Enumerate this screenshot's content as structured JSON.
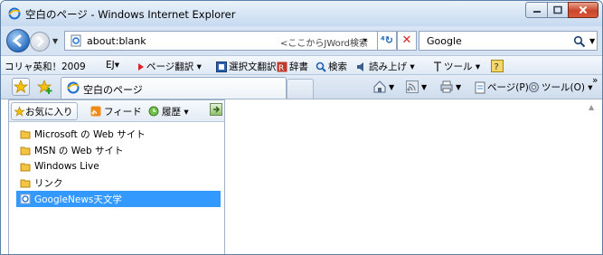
{
  "window": {
    "title": "空白のページ - Windows Internet Explorer",
    "icon": "ie-icon"
  },
  "address_bar": {
    "value": "about:blank",
    "hint": "<ここからJWord検索",
    "hint_dropdown": "▾"
  },
  "search": {
    "value": "Google"
  },
  "toolbar": {
    "items": [
      {
        "label": "コリャ英和！2009"
      },
      {
        "label": "EJ▾"
      },
      {
        "label": "ページ翻訳 ▾"
      },
      {
        "label": "選択文翻訳"
      },
      {
        "label": "辞書"
      },
      {
        "label": "検索"
      },
      {
        "label": "読み上げ ▾"
      },
      {
        "label": "ツール ▾"
      }
    ]
  },
  "tabs": {
    "active_label": "空白のページ"
  },
  "commands": {
    "page_label": "ページ(P) ▾",
    "tools_label": "ツール(O) ▾",
    "more": "»"
  },
  "favorites_pane": {
    "tabs": [
      {
        "label": "お気に入り"
      },
      {
        "label": "フィード"
      },
      {
        "label": "履歴 ▾"
      }
    ],
    "items": [
      {
        "label": "Microsoft の Web サイト",
        "icon": "folder-icon",
        "selected": false
      },
      {
        "label": "MSN の Web サイト",
        "icon": "folder-icon",
        "selected": false
      },
      {
        "label": "Windows Live",
        "icon": "folder-icon",
        "selected": false
      },
      {
        "label": "リンク",
        "icon": "folder-icon",
        "selected": false
      },
      {
        "label": "GoogleNews天文学",
        "icon": "ie-page-icon",
        "selected": true
      }
    ]
  },
  "colors": {
    "selection": "#3399ff",
    "close_button": "#c9452a",
    "title_gradient": "#d4e3f4"
  }
}
